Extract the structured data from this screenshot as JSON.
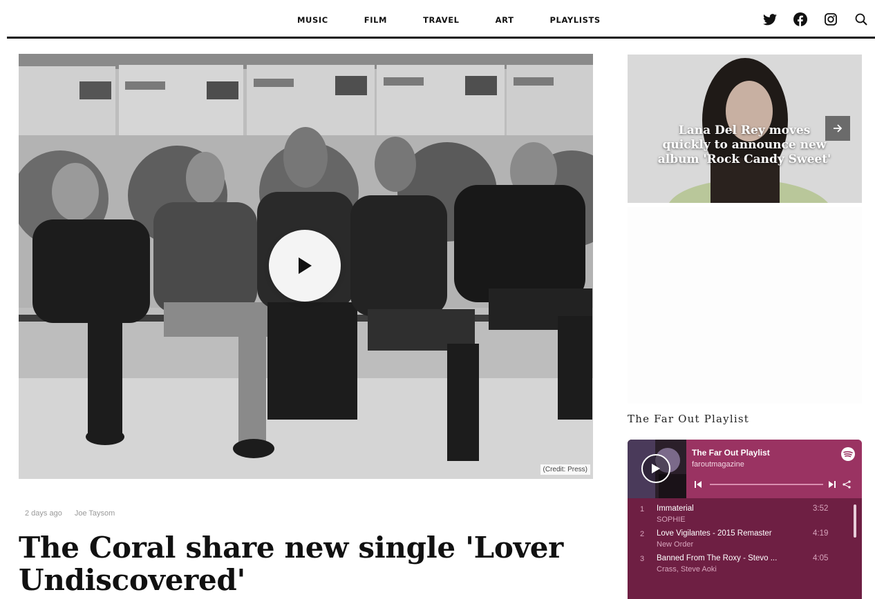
{
  "nav": {
    "items": [
      "MUSIC",
      "FILM",
      "TRAVEL",
      "ART",
      "PLAYLISTS"
    ]
  },
  "social": {
    "icons": [
      "twitter-icon",
      "facebook-icon",
      "instagram-icon",
      "search-icon"
    ]
  },
  "hero": {
    "credit": "(Credit: Press)"
  },
  "article": {
    "time": "2 days ago",
    "author": "Joe Taysom",
    "title": "The Coral share new single 'Lover Undiscovered'"
  },
  "sidebar": {
    "card_title": "Lana Del Rey moves quickly to announce new album 'Rock Candy Sweet'",
    "playlist_heading": "The Far Out Playlist"
  },
  "widget": {
    "title": "The Far Out Playlist",
    "owner": "faroutmagazine",
    "tracks": [
      {
        "num": "1",
        "name": "Immaterial",
        "artist": "SOPHIE",
        "duration": "3:52"
      },
      {
        "num": "2",
        "name": "Love Vigilantes - 2015 Remaster",
        "artist": "New Order",
        "duration": "4:19"
      },
      {
        "num": "3",
        "name": "Banned From The Roxy - Stevo ...",
        "artist": "Crass, Steve Aoki",
        "duration": "4:05"
      }
    ]
  },
  "colors": {
    "widget_bg": "#6e1f43",
    "widget_header": "#9a3362",
    "accent_text": "#d8a5bd"
  }
}
